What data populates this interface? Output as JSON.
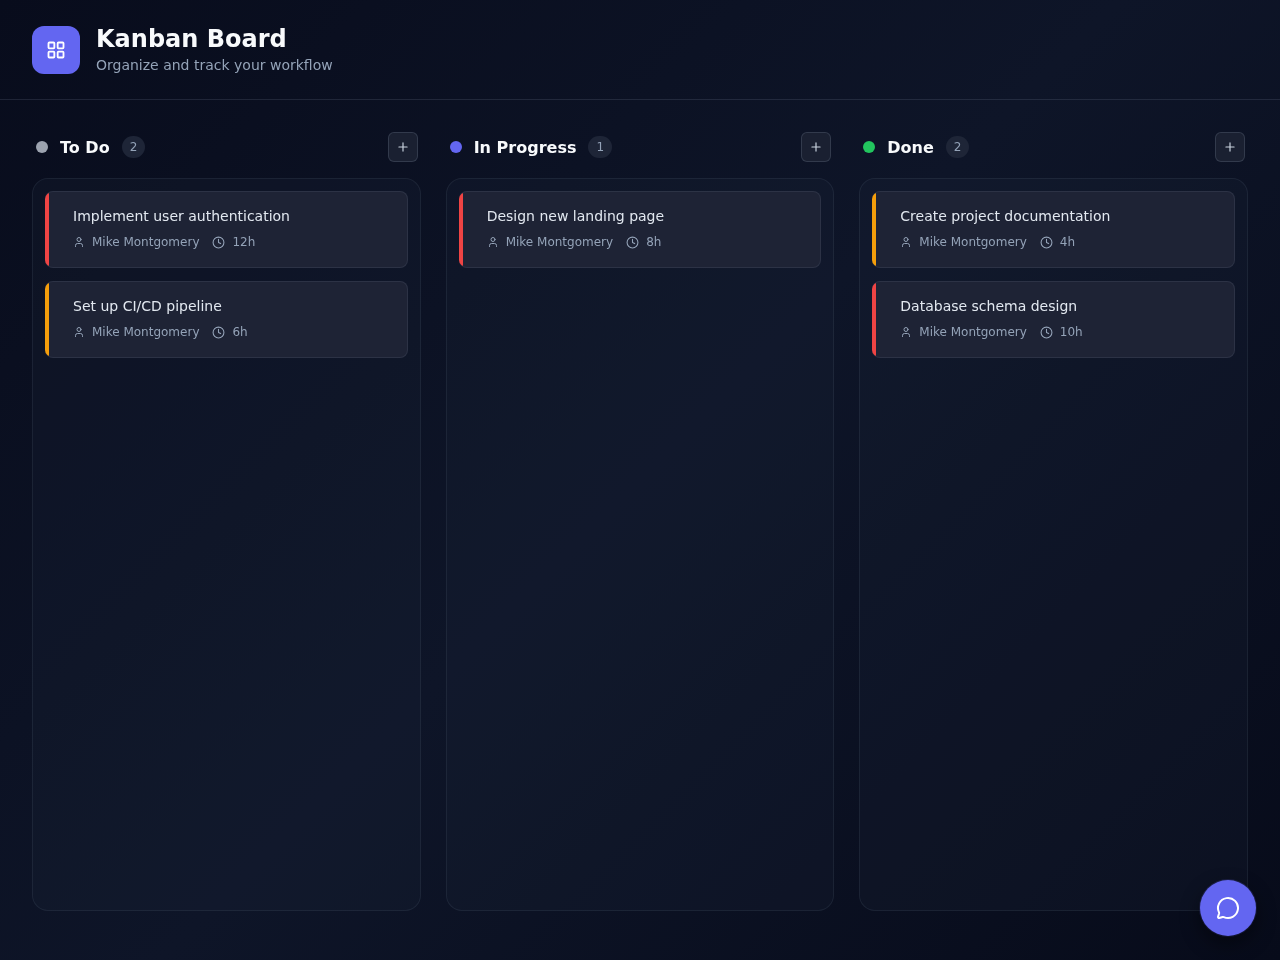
{
  "header": {
    "title": "Kanban Board",
    "subtitle": "Organize and track your workflow"
  },
  "columns": [
    {
      "title": "To Do",
      "color": "#9ca3af",
      "count": "2",
      "cards": [
        {
          "title": "Implement user authentication",
          "color": "#ef4444",
          "assignee": "Mike Montgomery",
          "estimate": "12h"
        },
        {
          "title": "Set up CI/CD pipeline",
          "color": "#f59e0b",
          "assignee": "Mike Montgomery",
          "estimate": "6h"
        }
      ]
    },
    {
      "title": "In Progress",
      "color": "#6366f1",
      "count": "1",
      "cards": [
        {
          "title": "Design new landing page",
          "color": "#ef4444",
          "assignee": "Mike Montgomery",
          "estimate": "8h"
        }
      ]
    },
    {
      "title": "Done",
      "color": "#22c55e",
      "count": "2",
      "cards": [
        {
          "title": "Create project documentation",
          "color": "#f59e0b",
          "assignee": "Mike Montgomery",
          "estimate": "4h"
        },
        {
          "title": "Database schema design",
          "color": "#ef4444",
          "assignee": "Mike Montgomery",
          "estimate": "10h"
        }
      ]
    }
  ]
}
